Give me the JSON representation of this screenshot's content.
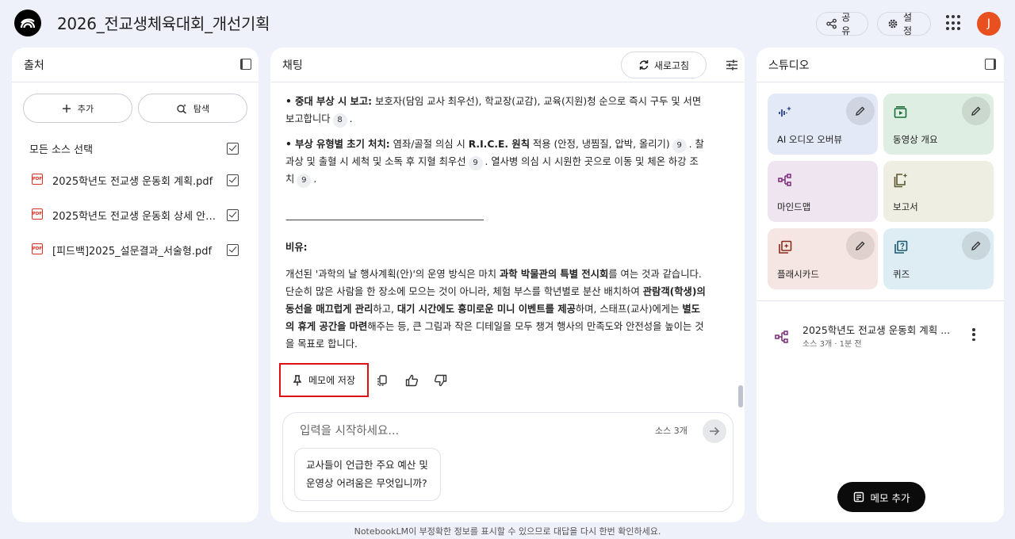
{
  "app": {
    "title": "2026_전교생체육대회_개선기획",
    "share_label": "공유",
    "settings_label": "설정",
    "avatar_initial": "J",
    "avatar_color": "#e8501f"
  },
  "sources": {
    "header": "출처",
    "add_label": "추가",
    "explore_label": "탐색",
    "select_all_label": "모든 소스 선택",
    "items": [
      {
        "icon": "pdf-icon",
        "label": "2025학년도 전교생 운동회 계획.pdf",
        "checked": true
      },
      {
        "icon": "pdf-icon",
        "label": "2025학년도 전교생 운동회 상세 안전 ...",
        "checked": true
      },
      {
        "icon": "pdf-icon",
        "label": "[피드백]2025_설문결과_서술형.pdf",
        "checked": true
      }
    ]
  },
  "chat": {
    "header": "채팅",
    "refresh_label": "새로고침",
    "p1": {
      "bullet": "• 중대 부상 시 보고:",
      "text": " 보호자(담임 교사 최우선), 학교장(교감), 교육(지원)청 순으로 즉시 구두 및 서면 보고합니다",
      "cite": "8",
      "end": "."
    },
    "p2": {
      "bullet": "• 부상 유형별 초기 처치:",
      "t1": " 염좌/골절 의심 시 ",
      "b1": "R.I.C.E. 원칙",
      "t2": " 적용 (안정, 냉찜질, 압박, 올리기)",
      "cite1": "9",
      "t3": ". 찰과상 및 출혈 시 세척 및 소독 후 지혈 최우선",
      "cite2": "9",
      "t4": ". 열사병 의심 시 시원한 곳으로 이동 및 체온 하강 조치",
      "cite3": "9",
      "end": "."
    },
    "divider": "----------------------------------------------------------------------------------------",
    "analogy_heading": "비유:",
    "analogy": {
      "t1": "개선된 '과학의 날 행사계획(안)'의 운영 방식은 마치 ",
      "b1": "과학 박물관의 특별 전시회",
      "t2": "를 여는 것과 같습니다. 단순히 많은 사람을 한 장소에 모으는 것이 아니라, 체험 부스를 학년별로 분산 배치하여 ",
      "b2": "관람객(학생)의 동선을 매끄럽게 관리",
      "t3": "하고, ",
      "b3": "대기 시간에도 흥미로운 미니 이벤트를 제공",
      "t4": "하며, 스태프(교사)에게는 ",
      "b4": "별도의 휴게 공간을 마련",
      "t5": "해주는 등, 큰 그림과 작은 디테일을 모두 챙겨 행사의 만족도와 안전성을 높이는 것을 목표로 합니다."
    },
    "save_memo_label": "메모에 저장",
    "input_placeholder": "입력을 시작하세요...",
    "source_count": "소스 3개",
    "suggestion": "교사들이 언급한 주요 예산 및 운영상 어려움은 무엇입니까?"
  },
  "studio": {
    "header": "스튜디오",
    "tiles": [
      {
        "label": "AI 오디오 오버뷰",
        "icon": "audio-wave-icon",
        "color": "#e4e9f7",
        "edit": true
      },
      {
        "label": "동영상 개요",
        "icon": "video-icon",
        "color": "#dfeee3",
        "edit": true
      },
      {
        "label": "마인드맵",
        "icon": "mindmap-icon",
        "color": "#efe5f0",
        "edit": false
      },
      {
        "label": "보고서",
        "icon": "report-icon",
        "color": "#efeee2",
        "edit": false
      },
      {
        "label": "플래시카드",
        "icon": "flashcard-icon",
        "color": "#f6e6e3",
        "edit": true
      },
      {
        "label": "퀴즈",
        "icon": "quiz-icon",
        "color": "#ddedf3",
        "edit": true
      }
    ],
    "note": {
      "title": "2025학년도 전교생 운동회 계획 ...",
      "meta": "소스 3개 · 1분 전"
    },
    "add_note_label": "메모 추가"
  },
  "footer": "NotebookLM이 부정확한 정보를 표시할 수 있으므로 대답을 다시 한번 확인하세요."
}
